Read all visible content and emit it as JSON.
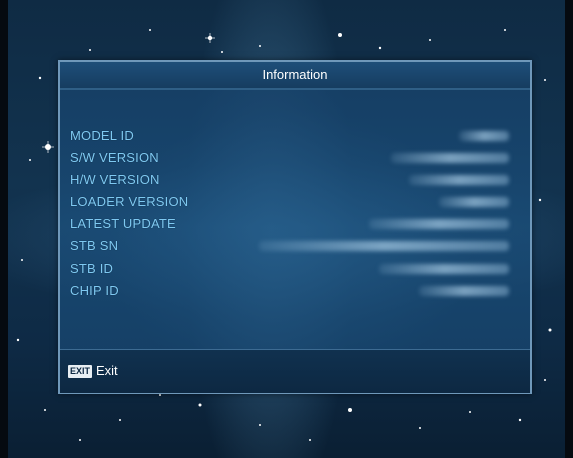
{
  "dialog": {
    "title": "Information",
    "rows": [
      {
        "label": "MODEL ID",
        "value": ""
      },
      {
        "label": "S/W VERSION",
        "value": ""
      },
      {
        "label": "H/W VERSION",
        "value": ""
      },
      {
        "label": "LOADER VERSION",
        "value": ""
      },
      {
        "label": "LATEST UPDATE",
        "value": ""
      },
      {
        "label": "STB SN",
        "value": ""
      },
      {
        "label": "STB ID",
        "value": ""
      },
      {
        "label": "CHIP ID",
        "value": ""
      }
    ]
  },
  "footer": {
    "exit_key": "EXIT",
    "exit_label": "Exit"
  },
  "colors": {
    "label": "#7ec9f2",
    "title_text": "#ffffff",
    "panel_border": "#6f98ba",
    "background": "#12334f"
  }
}
